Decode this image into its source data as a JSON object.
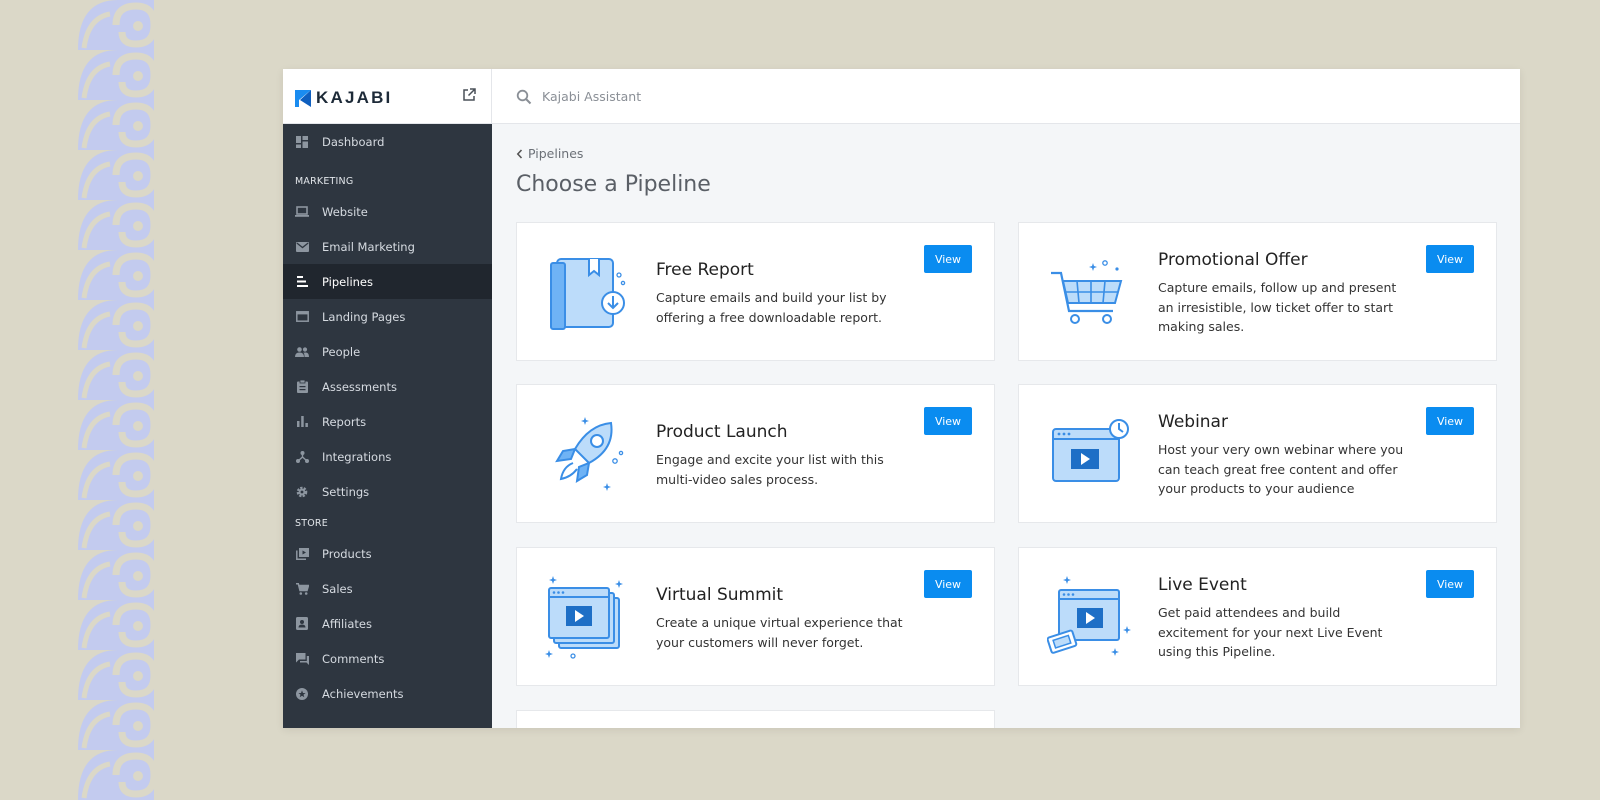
{
  "brand": {
    "logo_text": "KAJABI"
  },
  "search": {
    "placeholder": "Kajabi Assistant"
  },
  "sidebar": {
    "top_items": [
      {
        "label": "Dashboard",
        "icon": "dashboard-icon"
      }
    ],
    "sections": [
      {
        "title": "MARKETING",
        "items": [
          {
            "label": "Website",
            "icon": "laptop-icon"
          },
          {
            "label": "Email Marketing",
            "icon": "envelope-icon"
          },
          {
            "label": "Pipelines",
            "icon": "pipelines-icon",
            "active": true
          },
          {
            "label": "Landing Pages",
            "icon": "browser-window-icon"
          },
          {
            "label": "People",
            "icon": "people-icon"
          },
          {
            "label": "Assessments",
            "icon": "clipboard-icon"
          },
          {
            "label": "Reports",
            "icon": "bar-chart-icon"
          },
          {
            "label": "Integrations",
            "icon": "integrations-icon"
          },
          {
            "label": "Settings",
            "icon": "gear-icon"
          }
        ]
      },
      {
        "title": "STORE",
        "items": [
          {
            "label": "Products",
            "icon": "products-icon"
          },
          {
            "label": "Sales",
            "icon": "cart-icon"
          },
          {
            "label": "Affiliates",
            "icon": "affiliates-icon"
          },
          {
            "label": "Comments",
            "icon": "comments-icon"
          },
          {
            "label": "Achievements",
            "icon": "achievement-icon"
          }
        ]
      }
    ]
  },
  "main": {
    "breadcrumb": "Pipelines",
    "title": "Choose a Pipeline",
    "cards": [
      {
        "title": "Free Report",
        "desc": "Capture emails and build your list by offering a free downloadable report.",
        "button": "View",
        "icon": "report-download-icon"
      },
      {
        "title": "Promotional Offer",
        "desc": "Capture emails, follow up and present an irresistible, low ticket offer to start making sales.",
        "button": "View",
        "icon": "shopping-cart-icon"
      },
      {
        "title": "Product Launch",
        "desc": "Engage and excite your list with this multi-video sales process.",
        "button": "View",
        "icon": "rocket-icon"
      },
      {
        "title": "Webinar",
        "desc": "Host your very own webinar where you can teach great free content and offer your products to your audience",
        "button": "View",
        "icon": "webinar-video-icon"
      },
      {
        "title": "Virtual Summit",
        "desc": "Create a unique virtual experience that your customers will never forget.",
        "button": "View",
        "icon": "stacked-video-icon"
      },
      {
        "title": "Live Event",
        "desc": "Get paid attendees and build excitement for your next Live Event using this Pipeline.",
        "button": "View",
        "icon": "live-event-ticket-icon"
      }
    ]
  },
  "colors": {
    "accent": "#0a8cf0",
    "sidebar": "#2e3640",
    "sidebar_active": "#20262e",
    "illustration_fill": "#bcdcfa",
    "illustration_stroke": "#3a8ee6"
  }
}
